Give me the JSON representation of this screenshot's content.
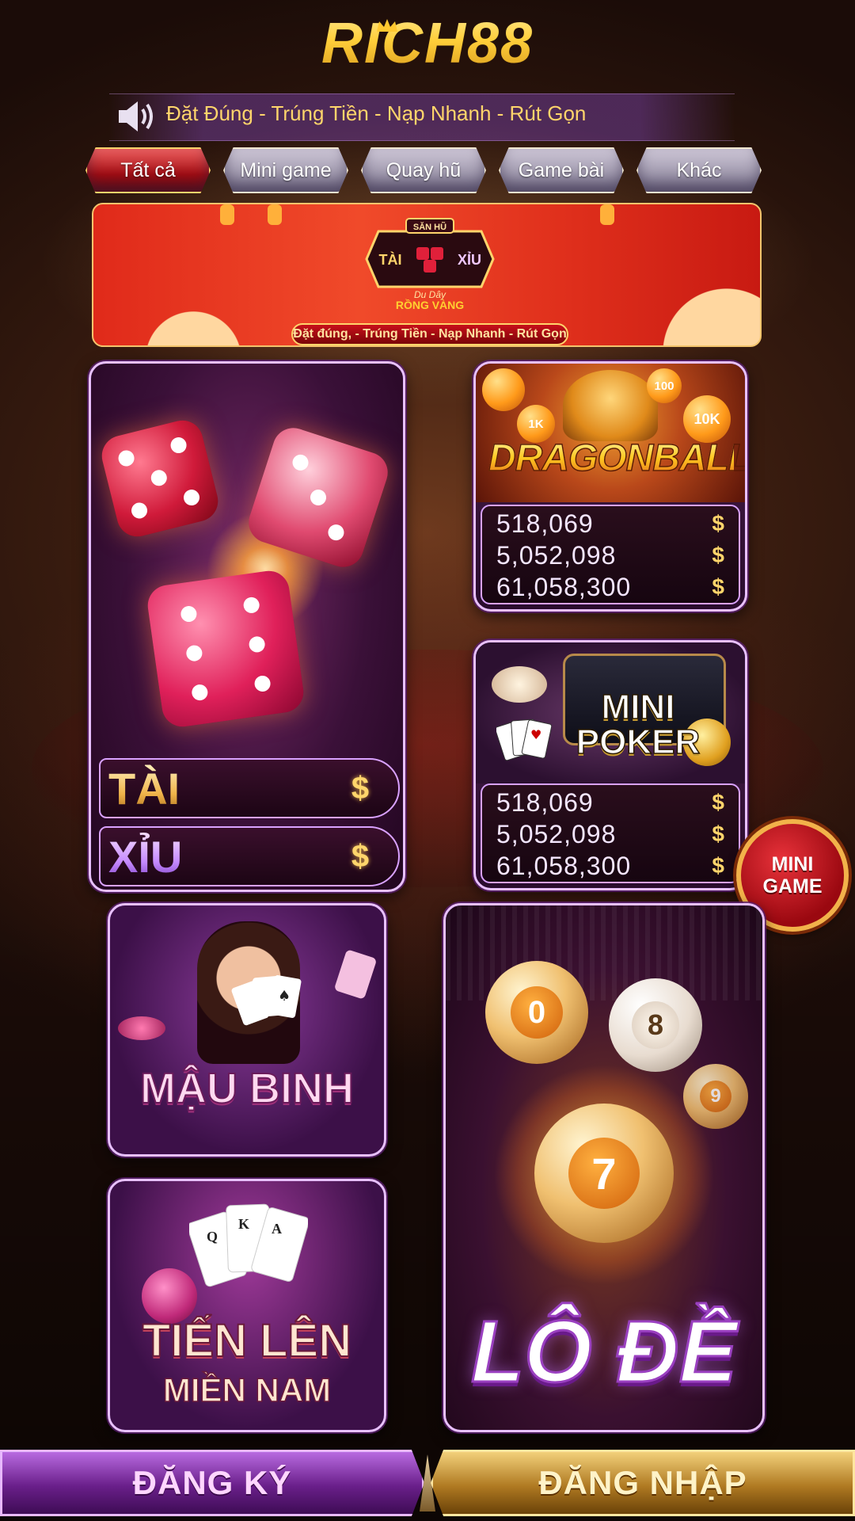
{
  "brand": {
    "logo_text": "RICH88"
  },
  "marquee": {
    "text": "Đặt Đúng  - Trúng Tiền - Nạp Nhanh - Rút Gọn"
  },
  "tabs": [
    {
      "label": "Tất cả",
      "active": true
    },
    {
      "label": "Mini game",
      "active": false
    },
    {
      "label": "Quay hũ",
      "active": false
    },
    {
      "label": "Game bài",
      "active": false
    },
    {
      "label": "Khác",
      "active": false
    }
  ],
  "banner": {
    "emblem_top": "SĂN HŨ",
    "emblem_left": "TÀI",
    "emblem_right": "XỈU",
    "emblem_title_line1": "Du Dây",
    "emblem_title_line2": "RỒNG VÀNG",
    "caption": "Đặt đúng, - Trúng Tiền - Nạp Nhanh - Rút Gọn"
  },
  "games": {
    "taixiu": {
      "tai_label": "TÀI",
      "xiu_label": "XỈU",
      "coin_symbol": "$"
    },
    "dragonball": {
      "title": "DRAGONBALLZ",
      "ball_labels": [
        "1K",
        "100",
        "10K"
      ],
      "jackpots": [
        "518,069",
        "5,052,098",
        "61,058,300"
      ],
      "coin_symbol": "$"
    },
    "minipoker": {
      "title_line1": "MINI",
      "title_line2": "POKER",
      "jackpots": [
        "518,069",
        "5,052,098",
        "61,058,300"
      ],
      "coin_symbol": "$"
    },
    "maubinh": {
      "title": "MẬU BINH"
    },
    "tienlen": {
      "title": "TIẾN LÊN",
      "subtitle": "MIỀN NAM",
      "card_letters": [
        "Q",
        "K",
        "A"
      ]
    },
    "lode": {
      "title": "LÔ ĐỀ",
      "ball_numbers": [
        "0",
        "8",
        "9",
        "7"
      ]
    }
  },
  "mini_game_button": {
    "line1": "MINI",
    "line2": "GAME"
  },
  "actions": {
    "register": "ĐĂNG KÝ",
    "login": "ĐĂNG NHẬP"
  },
  "colors": {
    "gold": "#ffd56b",
    "purple_border": "#e8c0ff",
    "active_tab": "#a00c12"
  }
}
